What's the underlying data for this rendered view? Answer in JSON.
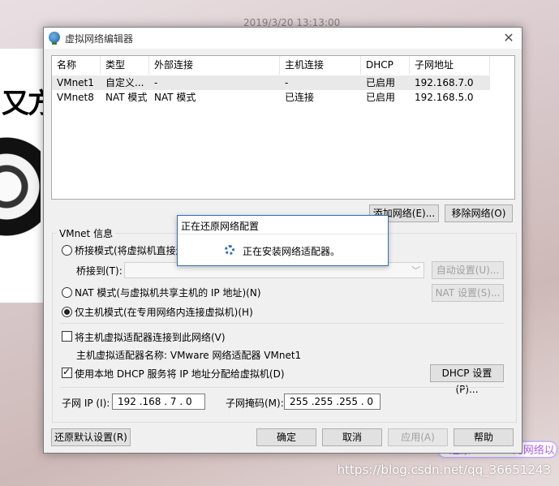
{
  "background": {
    "timestamp": "2019/3/20 13:13:00",
    "sticker_text": "又方",
    "watermark": "https://blog.csdn.net/qq_36651243",
    "pill_text": "还原VMware的网络以后"
  },
  "window": {
    "title": "虚拟网络编辑器",
    "close_glyph": "✕"
  },
  "table": {
    "columns": [
      "名称",
      "类型",
      "外部连接",
      "主机连接",
      "DHCP",
      "子网地址"
    ],
    "rows": [
      {
        "name": "VMnet1",
        "type": "自定义...",
        "external": "-",
        "host": "-",
        "dhcp": "已启用",
        "subnet": "192.168.7.0"
      },
      {
        "name": "VMnet8",
        "type": "NAT 模式",
        "external": "NAT 模式",
        "host": "已连接",
        "dhcp": "已启用",
        "subnet": "192.168.5.0"
      }
    ]
  },
  "buttons": {
    "add_network": "添加网络(E)...",
    "remove_network": "移除网络(O)",
    "auto_settings": "自动设置(U)...",
    "nat_settings": "NAT 设置(S)...",
    "dhcp_settings": "DHCP 设置(P)...",
    "restore_defaults": "还原默认设置(R)",
    "ok": "确定",
    "cancel": "取消",
    "apply": "应用(A)",
    "help": "帮助"
  },
  "vmnet_info": {
    "label": "VMnet 信息",
    "bridged_label": "桥接模式(将虚拟机直接连",
    "bridged_to_label": "桥接到(T):",
    "nat_label": "NAT 模式(与虚拟机共享主机的 IP 地址)(N)",
    "host_only_label": "仅主机模式(在专用网络内连接虚拟机)(H)",
    "selected_mode": "host_only",
    "connect_adapter_label": "将主机虚拟适配器连接到此网络(V)",
    "connect_adapter_checked": false,
    "adapter_name_label": "主机虚拟适配器名称: VMware 网络适配器 VMnet1",
    "dhcp_label": "使用本地 DHCP 服务将 IP 地址分配给虚拟机(D)",
    "dhcp_checked": true,
    "subnet_ip_label": "子网 IP (I):",
    "subnet_ip_value": "192 .168 . 7 . 0",
    "subnet_mask_label": "子网掩码(M):",
    "subnet_mask_value": "255 .255 .255 . 0"
  },
  "progress_dialog": {
    "title": "正在还原网络配置",
    "message": "正在安装网络适配器。"
  }
}
